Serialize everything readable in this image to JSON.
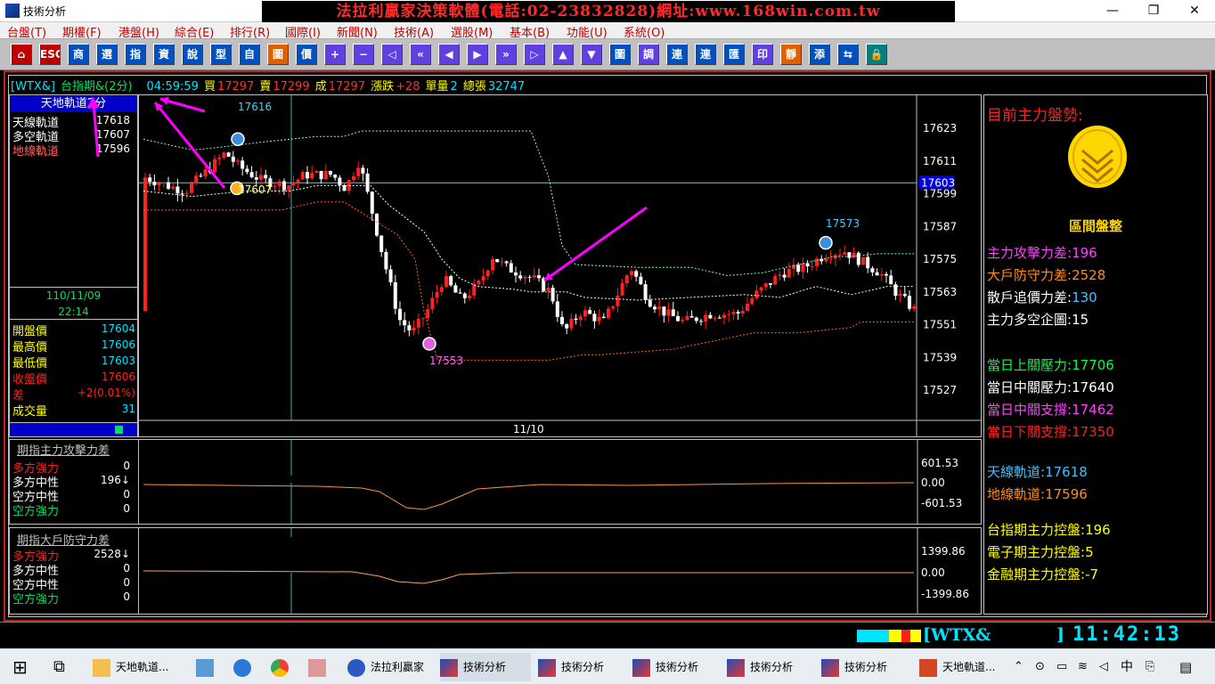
{
  "window": {
    "title": "技術分析",
    "ad_banner": "法拉利贏家決策軟體(電話:02-23832828)網址:www.168win.com.tw",
    "minimize": "—",
    "restore": "❐",
    "close": "✕"
  },
  "menu": [
    "台盤(T)",
    "期權(F)",
    "港盤(H)",
    "綜合(E)",
    "排行(R)",
    "國際(I)",
    "新聞(N)",
    "技術(A)",
    "選股(M)",
    "基本(B)",
    "功能(U)",
    "系統(O)"
  ],
  "toolbar": [
    "⌂",
    "ESC",
    "商",
    "選",
    "指",
    "資",
    "說",
    "型",
    "自",
    "圖",
    "價",
    "+",
    "−",
    "◁",
    "«",
    "◀",
    "▶",
    "»",
    "▷",
    "▲",
    "▼",
    "圖",
    "調",
    "連",
    "連",
    "匯",
    "印",
    "靜",
    "添",
    "⇆",
    "🔒"
  ],
  "infobar": {
    "code": "[WTX&]",
    "name": "台指期&(2分)",
    "time": "04:59:59",
    "buy_label": "買",
    "buy": "17297",
    "sell_label": "賣",
    "sell": "17299",
    "deal_label": "成",
    "deal": "17297",
    "change_label": "漲跌",
    "change": "+28",
    "vol_label": "單量",
    "vol": "2",
    "total_label": "總張",
    "total": "32747"
  },
  "left": {
    "header": "天地軌道2分",
    "rails": [
      {
        "label": "天線軌道",
        "value": "17618",
        "color": "#ffffff"
      },
      {
        "label": "多空軌道",
        "value": "17607",
        "color": "#ffffff"
      },
      {
        "label": "地線軌道",
        "value": "17596",
        "color": "#ff6060"
      }
    ],
    "date": "110/11/09",
    "time": "22:14",
    "quotes": [
      {
        "label": "開盤價",
        "value": "17604",
        "lc": "#ffff00",
        "vc": "#00e5ff"
      },
      {
        "label": "最高價",
        "value": "17606",
        "lc": "#ffff00",
        "vc": "#00e5ff"
      },
      {
        "label": "最低價",
        "value": "17603",
        "lc": "#ffff00",
        "vc": "#00e5ff"
      },
      {
        "label": "收盤價",
        "value": "17606",
        "lc": "#ff2020",
        "vc": "#ff2020"
      },
      {
        "label": "差",
        "value": "+2(0.01%)",
        "lc": "#ff2020",
        "vc": "#ff2020"
      },
      {
        "label": "成交量",
        "value": "31",
        "lc": "#ffff00",
        "vc": "#00e5ff"
      }
    ]
  },
  "main_chart": {
    "y_ticks": [
      "17623",
      "17611",
      "17599",
      "17587",
      "17575",
      "17563",
      "17551",
      "17539",
      "17527"
    ],
    "current": "17603",
    "x_label": "11/10",
    "markers": [
      "17616",
      "17607",
      "17553",
      "17573"
    ]
  },
  "sub1": {
    "title": "期指主力攻擊力差",
    "rows": [
      {
        "label": "多方強力",
        "value": "0",
        "color": "#ff2020"
      },
      {
        "label": "多方中性",
        "value": "196↓",
        "color": "#ffffff"
      },
      {
        "label": "空方中性",
        "value": "0",
        "color": "#ffffff"
      },
      {
        "label": "空方強力",
        "value": "0",
        "color": "#00e060"
      }
    ],
    "ticks": [
      "601.53",
      "0.00",
      "-601.53"
    ]
  },
  "sub2": {
    "title": "期指大戶防守力差",
    "rows": [
      {
        "label": "多方強力",
        "value": "2528↓",
        "color": "#ff2020"
      },
      {
        "label": "多方中性",
        "value": "0",
        "color": "#ffffff"
      },
      {
        "label": "空方中性",
        "value": "0",
        "color": "#ffffff"
      },
      {
        "label": "空方強力",
        "value": "0",
        "color": "#00e060"
      }
    ],
    "ticks": [
      "1399.86",
      "0.00",
      "-1399.86"
    ]
  },
  "right": {
    "title": "目前主力盤勢:",
    "coin_label": "區間盤整",
    "group1": [
      {
        "label": "主力攻擊力差:",
        "value": "196",
        "color": "#ff40ff"
      },
      {
        "label": "大戶防守力差:",
        "value": "2528",
        "color": "#ff8c1a"
      },
      {
        "label": "散戶追價力差:",
        "value": "130",
        "color": "#40c0ff"
      },
      {
        "label": "主力多空企圖:",
        "value": "15",
        "color": "#ffffff"
      }
    ],
    "group2": [
      {
        "label": "當日上關壓力:",
        "value": "17706",
        "color": "#00ff40"
      },
      {
        "label": "當日中關壓力:",
        "value": "17640",
        "color": "#ffffff"
      },
      {
        "label": "當日中關支撐:",
        "value": "17462",
        "color": "#ff40ff"
      },
      {
        "label": "當日下關支撐:",
        "value": "17350",
        "color": "#ff2020"
      }
    ],
    "group3": [
      {
        "label": "天線軌道:",
        "value": "17618",
        "color": "#40c0ff"
      },
      {
        "label": "地線軌道:",
        "value": "17596",
        "color": "#ff8c1a"
      }
    ],
    "group4": [
      {
        "label": "台指期主力控盤:",
        "value": "196",
        "color": "#ffff00"
      },
      {
        "label": "電子期主力控盤:",
        "value": "5",
        "color": "#ffff00"
      },
      {
        "label": "金融期主力控盤:",
        "value": "-7",
        "color": "#ffff00"
      }
    ]
  },
  "status": {
    "code": "[WTX&",
    "bracket": "]",
    "clock": "11:42:13"
  },
  "taskbar": {
    "items": [
      "天地軌道...",
      "法拉利贏家",
      "技術分析",
      "技術分析",
      "技術分析",
      "技術分析",
      "技術分析",
      "天地軌道..."
    ],
    "lang": "中"
  }
}
